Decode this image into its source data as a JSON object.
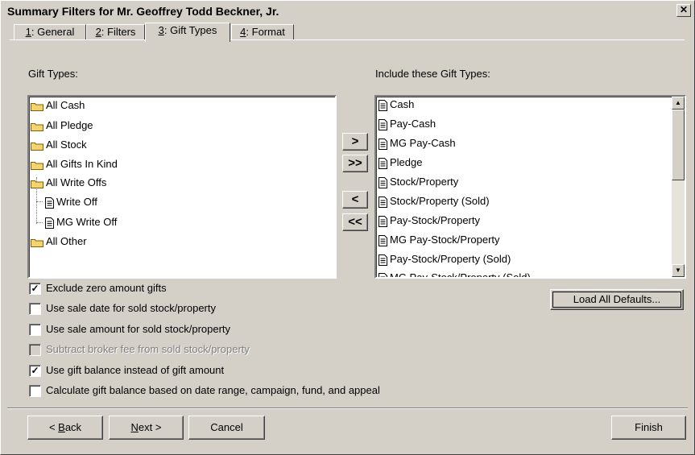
{
  "window": {
    "title": "Summary Filters for Mr. Geoffrey Todd Beckner, Jr.",
    "close_glyph": "✕"
  },
  "tabs": [
    {
      "key": "1",
      "label": ": General"
    },
    {
      "key": "2",
      "label": ": Filters"
    },
    {
      "key": "3",
      "label": ": Gift Types"
    },
    {
      "key": "4",
      "label": ": Format"
    }
  ],
  "gift_types": {
    "label": "Gift Types:",
    "items": [
      {
        "label": "All Cash",
        "icon": "folder-icon"
      },
      {
        "label": "All Pledge",
        "icon": "folder-icon"
      },
      {
        "label": "All Stock",
        "icon": "folder-icon"
      },
      {
        "label": "All Gifts In Kind",
        "icon": "folder-icon"
      },
      {
        "label": "All Write Offs",
        "icon": "folder-icon"
      },
      {
        "label": "Write Off",
        "icon": "document-icon"
      },
      {
        "label": "MG Write Off",
        "icon": "document-icon"
      },
      {
        "label": "All Other",
        "icon": "folder-icon"
      }
    ]
  },
  "include_types": {
    "label": "Include these Gift Types:",
    "items": [
      "Cash",
      "Pay-Cash",
      "MG Pay-Cash",
      "Pledge",
      "Stock/Property",
      "Stock/Property (Sold)",
      "Pay-Stock/Property",
      "MG Pay-Stock/Property",
      "Pay-Stock/Property (Sold)",
      "MG Pay-Stock/Property (Sold)"
    ]
  },
  "move_buttons": {
    "add": ">",
    "add_all": ">>",
    "remove": "<",
    "remove_all": "<<"
  },
  "load_defaults": "Load All Defaults...",
  "options": [
    {
      "label": "Exclude zero amount gifts",
      "checked": true,
      "enabled": true
    },
    {
      "label": "Use sale date for sold stock/property",
      "checked": false,
      "enabled": true
    },
    {
      "label": "Use sale amount for sold stock/property",
      "checked": false,
      "enabled": true
    },
    {
      "label": "Subtract broker fee from sold stock/property",
      "checked": false,
      "enabled": false
    },
    {
      "label": "Use gift balance instead of gift amount",
      "checked": true,
      "enabled": true
    },
    {
      "label": "Calculate gift balance based on date range, campaign, fund, and appeal",
      "checked": false,
      "enabled": true
    }
  ],
  "footer": {
    "back_prefix": "< ",
    "back_key": "B",
    "back_rest": "ack",
    "next_key": "N",
    "next_rest": "ext >",
    "cancel": "Cancel",
    "finish": "Finish"
  },
  "colors": {
    "face": "#d4d0c8",
    "shadow": "#808080",
    "folder": "#f2d472"
  }
}
